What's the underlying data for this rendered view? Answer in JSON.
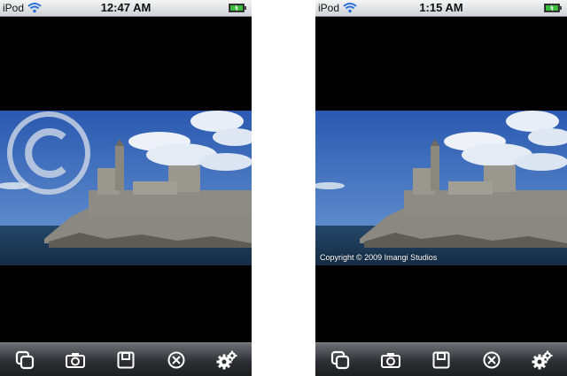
{
  "screens": [
    {
      "status_bar": {
        "carrier": "iPod",
        "time": "12:47 AM"
      },
      "watermark_icon": "copyright-watermark-icon",
      "caption": ""
    },
    {
      "status_bar": {
        "carrier": "iPod",
        "time": "1:15 AM"
      },
      "watermark_icon": "",
      "caption": "Copyright © 2009 Imangi Studios"
    }
  ],
  "toolbar_icons": [
    "duplicate-icon",
    "camera-icon",
    "save-icon",
    "close-circle-icon",
    "gear-icon"
  ],
  "colors": {
    "status_bar": "#dfe2e6",
    "battery": "#3dbb3d",
    "toolbar": "#2c2f33",
    "sky": "#2f62b8",
    "sea": "#1f3f5e"
  }
}
